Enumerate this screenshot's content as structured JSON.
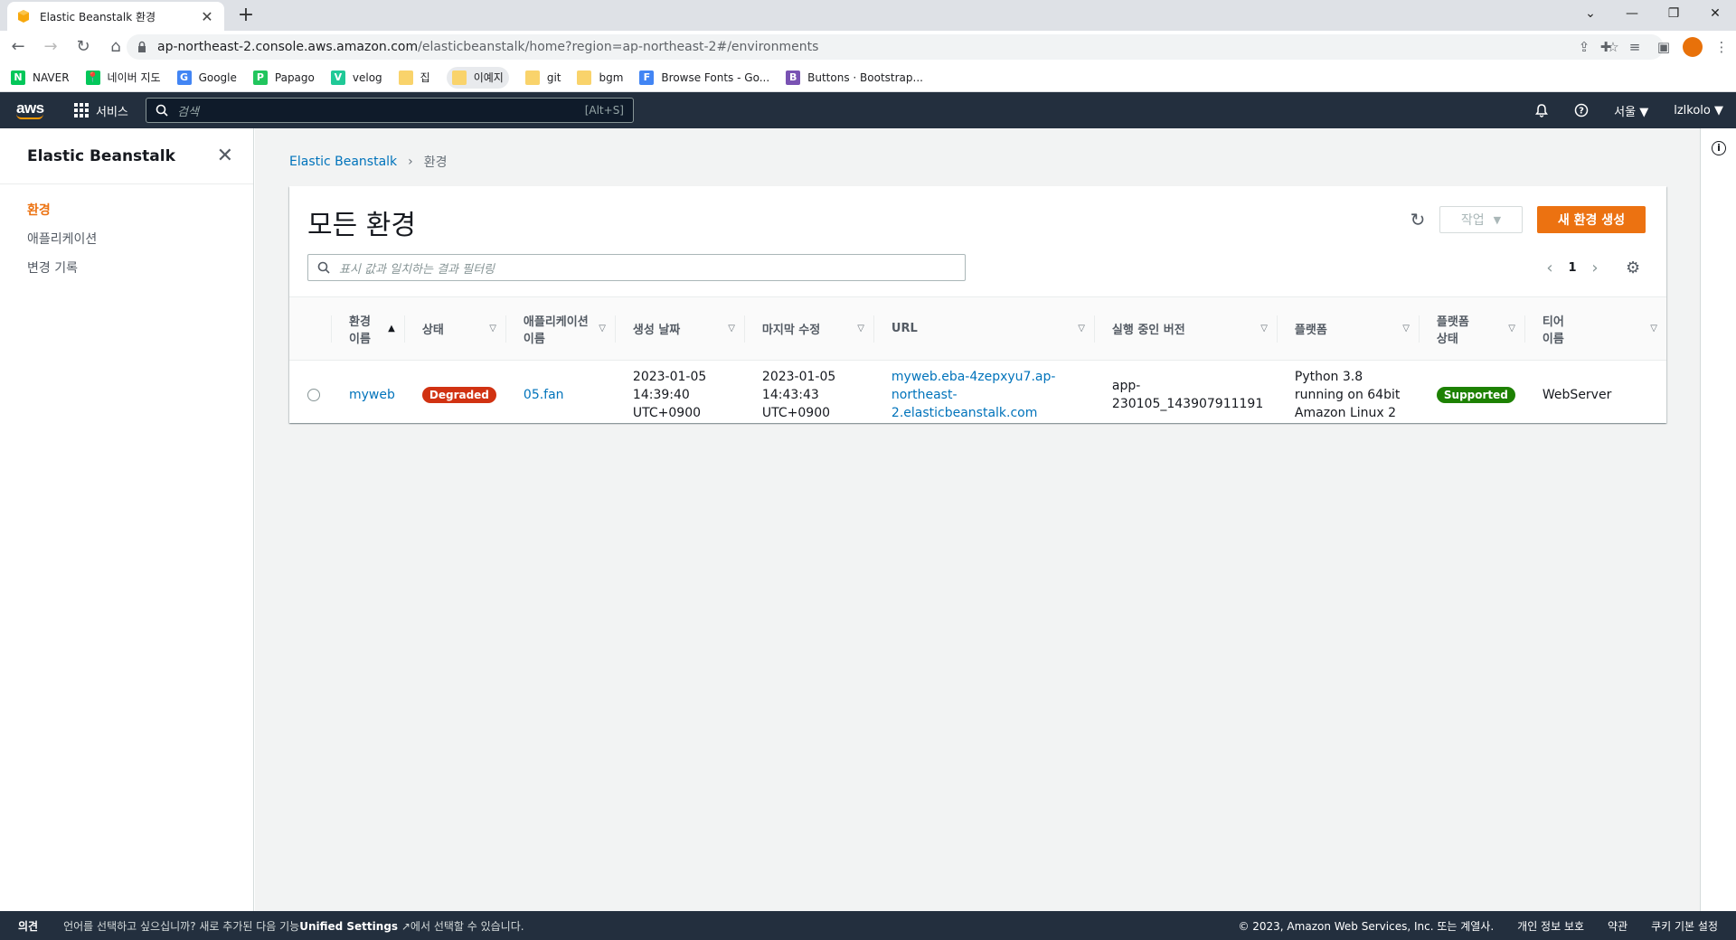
{
  "browser": {
    "tab_title": "Elastic Beanstalk 환경",
    "url_host": "ap-northeast-2.console.aws.amazon.com",
    "url_path": "/elasticbeanstalk/home?region=ap-northeast-2#/environments",
    "bookmarks": [
      {
        "label": "NAVER",
        "color": "#03c75a",
        "glyph": "N"
      },
      {
        "label": "네이버 지도",
        "color": "#03c75a",
        "glyph": "📍"
      },
      {
        "label": "Google",
        "color": "#4285f4",
        "glyph": "G"
      },
      {
        "label": "Papago",
        "color": "#21c55d",
        "glyph": "P"
      },
      {
        "label": "velog",
        "color": "#20c997",
        "glyph": "V"
      },
      {
        "label": "집",
        "color": "#f9d36b",
        "glyph": ""
      },
      {
        "label": "이예지",
        "color": "#f9d36b",
        "glyph": ""
      },
      {
        "label": "git",
        "color": "#f9d36b",
        "glyph": ""
      },
      {
        "label": "bgm",
        "color": "#f9d36b",
        "glyph": ""
      },
      {
        "label": "Browse Fonts - Go...",
        "color": "#4285f4",
        "glyph": "F"
      },
      {
        "label": "Buttons · Bootstrap...",
        "color": "#7952b3",
        "glyph": "B"
      }
    ]
  },
  "aws_header": {
    "logo": "aws",
    "services_label": "서비스",
    "search_placeholder": "검색",
    "search_shortcut": "[Alt+S]",
    "region": "서울 ▼",
    "user": "lzlkolo ▼"
  },
  "sidenav": {
    "title": "Elastic Beanstalk",
    "items": [
      {
        "label": "환경",
        "active": true
      },
      {
        "label": "애플리케이션",
        "active": false
      },
      {
        "label": "변경 기록",
        "active": false
      }
    ]
  },
  "breadcrumb": {
    "root": "Elastic Beanstalk",
    "current": "환경"
  },
  "panel": {
    "title": "모든 환경",
    "action_label": "작업",
    "create_label": "새 환경 생성",
    "filter_placeholder": "표시 값과 일치하는 결과 필터링",
    "page": "1"
  },
  "table": {
    "headers": [
      {
        "label": "환경\n이름",
        "sort": "▲"
      },
      {
        "label": "상태",
        "sort": "▽"
      },
      {
        "label": "애플리케이션\n이름",
        "sort": "▽"
      },
      {
        "label": "생성 날짜",
        "sort": "▽"
      },
      {
        "label": "마지막 수정",
        "sort": "▽"
      },
      {
        "label": "URL",
        "sort": "▽"
      },
      {
        "label": "실행 중인 버전",
        "sort": "▽"
      },
      {
        "label": "플랫폼",
        "sort": "▽"
      },
      {
        "label": "플랫폼\n상태",
        "sort": "▽"
      },
      {
        "label": "티어\n이름",
        "sort": "▽"
      }
    ],
    "rows": [
      {
        "env_name": "myweb",
        "status": "Degraded",
        "app_name": "05.fan",
        "created": "2023-01-05\n14:39:40\nUTC+0900",
        "modified": "2023-01-05\n14:43:43\nUTC+0900",
        "url": "myweb.eba-4zepxyu7.ap-\nnortheast-\n2.elasticbeanstalk.com",
        "version": "app-\n230105_143907911191",
        "platform": "Python 3.8\nrunning on 64bit\nAmazon Linux 2",
        "platform_status": "Supported",
        "tier": "WebServer"
      }
    ]
  },
  "footer": {
    "feedback": "의견",
    "lang_prefix": "언어를 선택하고 싶으십니까? 새로 추가된 다음 기능",
    "lang_link": "Unified Settings",
    "lang_suffix": "에서 선택할 수 있습니다.",
    "copyright": "© 2023, Amazon Web Services, Inc. 또는 계열사.",
    "privacy": "개인 정보 보호",
    "terms": "약관",
    "cookies": "쿠키 기본 설정"
  }
}
